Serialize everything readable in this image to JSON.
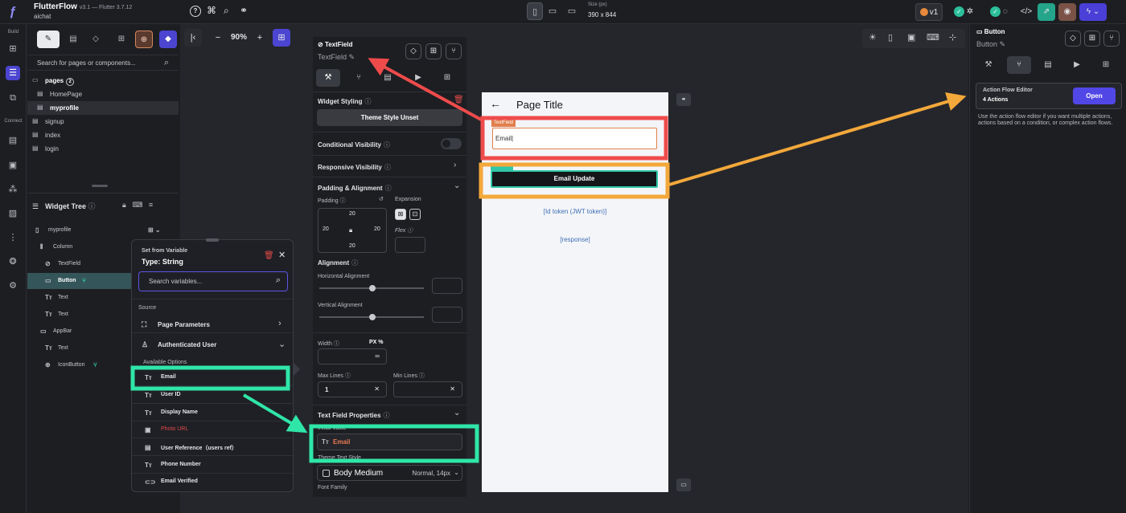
{
  "app": {
    "name": "FlutterFlow",
    "version": "v3.1 — Flutter 3.7.12",
    "project": "aichat"
  },
  "topbar": {
    "size_label": "Size (px)",
    "size_value": "390 x 844",
    "version_badge": "v1"
  },
  "rail": {
    "build_label": "Build",
    "connect_label": "Connect"
  },
  "pages_panel": {
    "search_placeholder": "Search for pages or components...",
    "folder_label": "pages",
    "folder_count": "2",
    "items": [
      "HomePage",
      "myprofile",
      "signup",
      "index",
      "login"
    ]
  },
  "widget_tree": {
    "title": "Widget Tree",
    "items": [
      {
        "label": "myprofile",
        "icon": "phone-icon"
      },
      {
        "label": "Column",
        "icon": "column-icon"
      },
      {
        "label": "TextField",
        "icon": "textfield-icon"
      },
      {
        "label": "Button",
        "icon": "button-icon"
      },
      {
        "label": "Text",
        "icon": "text-icon"
      },
      {
        "label": "Text",
        "icon": "text-icon"
      },
      {
        "label": "AppBar",
        "icon": "appbar-icon"
      },
      {
        "label": "Text",
        "icon": "text-icon"
      },
      {
        "label": "IconButton",
        "icon": "iconbutton-icon"
      }
    ]
  },
  "canvas": {
    "zoom": "90%"
  },
  "props": {
    "title": "TextField",
    "subtitle": "TextField",
    "widget_styling": "Widget Styling",
    "theme_style": "Theme Style Unset",
    "conditional_visibility": "Conditional Visibility",
    "responsive_visibility": "Responsive Visibility",
    "padding_alignment": "Padding & Alignment",
    "padding_label": "Padding",
    "expansion_label": "Expansion",
    "padding": {
      "top": "20",
      "left": "20",
      "right": "20",
      "bottom": "20"
    },
    "flex_label": "Flex",
    "alignment_label": "Alignment",
    "horizontal_alignment": "Horizontal Alignment",
    "vertical_alignment": "Vertical Alignment",
    "width_label": "Width",
    "width_units": "PX  %",
    "width_value": "∞",
    "max_lines_label": "Max Lines",
    "min_lines_label": "Min Lines",
    "max_lines_value": "1",
    "text_field_properties": "Text Field Properties",
    "initial_value_label": "Initial Value",
    "initial_value": "Email",
    "theme_text_style_label": "Theme Text Style",
    "text_style": "Body Medium",
    "text_style_value": "Normal, 14px",
    "font_family_label": "Font Family"
  },
  "phone": {
    "page_title": "Page Title",
    "textfield_tag": "TextField",
    "textfield_value": "Email|",
    "button_label": "Email Update",
    "id_token_text": "[Id token (JWT token)]",
    "response_text": "[response]"
  },
  "popup": {
    "title": "Set from Variable",
    "type": "Type: String",
    "search_placeholder": "Search variables...",
    "source_label": "Source",
    "page_parameters": "Page Parameters",
    "authenticated_user": "Authenticated User",
    "available_options": "Available Options",
    "options": [
      {
        "label": "Email",
        "icon": "text-icon"
      },
      {
        "label": "User ID",
        "icon": "text-icon"
      },
      {
        "label": "Display Name",
        "icon": "text-icon"
      },
      {
        "label": "Photo URL",
        "icon": "image-icon"
      },
      {
        "label": "User Reference（users ref）",
        "icon": "reference-icon"
      },
      {
        "label": "Phone Number",
        "icon": "text-icon"
      },
      {
        "label": "Email Verified",
        "icon": "toggle-icon"
      }
    ]
  },
  "right_panel": {
    "title": "Button",
    "subtitle": "Button",
    "afe_title": "Action Flow Editor",
    "afe_count": "4 Actions",
    "afe_open": "Open",
    "afe_desc": "Use the action flow editor if you want multiple actions, actions based on a condition, or complex action flows."
  },
  "colors": {
    "accent_purple": "#4b45d1",
    "teal": "#37d3b2",
    "highlight_red": "#ef4b4b",
    "highlight_orange": "#f3a83b",
    "highlight_green": "#2fe6a8"
  }
}
